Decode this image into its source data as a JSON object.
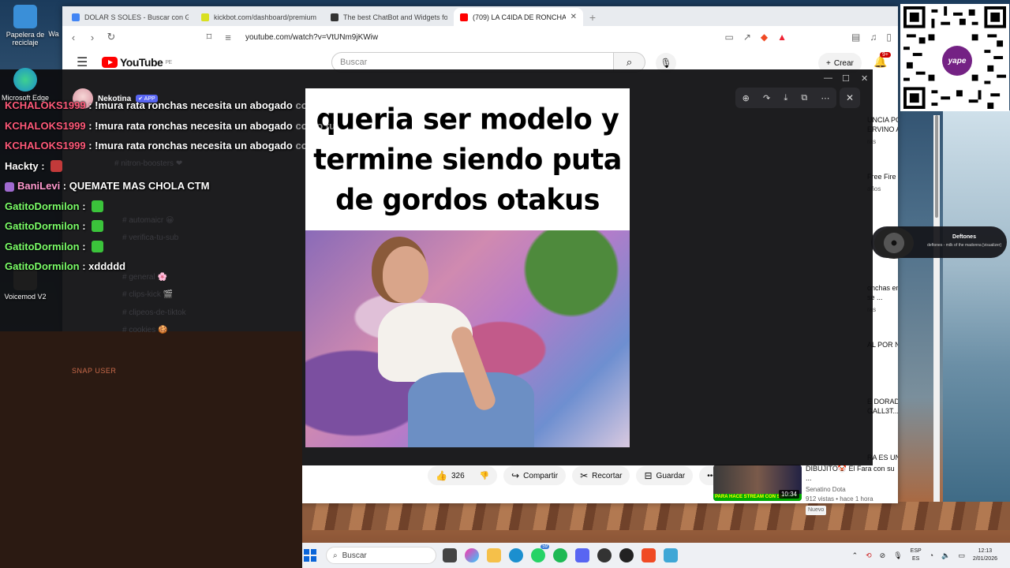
{
  "desktop": {
    "icons": [
      {
        "label": "Papelera de reciclaje",
        "color": "#3a8fd8"
      },
      {
        "label": "Microsoft Edge",
        "color": "#1b8fcf"
      },
      {
        "label": "Voicemod V2",
        "color": "#1d1d1d"
      }
    ],
    "partial_label": "Wa"
  },
  "browser": {
    "tabs": [
      {
        "title": "DOLAR S SOLES - Buscar con Google",
        "favicon_color": "#4285f4"
      },
      {
        "title": "kickbot.com/dashboard/premium",
        "favicon_color": "#d9e021"
      },
      {
        "title": "The best ChatBot and Widgets for K...",
        "favicon_color": "#333333"
      },
      {
        "title": "(709) LA C4IDA DE RONCHAS K...",
        "favicon_color": "#ff0000"
      }
    ],
    "url": "youtube.com/watch?v=VtUNm9jKWiw"
  },
  "youtube": {
    "logo_text": "YouTube",
    "region": "PE",
    "search_placeholder": "Buscar",
    "create_label": "Crear",
    "notifications_badge": "9+",
    "likes": "326",
    "share_label": "Compartir",
    "clip_label": "Recortar",
    "save_label": "Guardar",
    "recommendations": [
      {
        "title": "UNCIA POR ERVINO A ...",
        "meta": "ras"
      },
      {
        "title": "Free Fire Song ...",
        "meta": "años"
      },
      {
        "title": "onchas en la ómo se ...",
        "meta": "ras"
      },
      {
        "title": "AL POR N SU ...",
        "meta": ""
      },
      {
        "title": "E DORADA Á GALL3T...",
        "meta": ""
      },
      {
        "title": "RA ES UN",
        "meta": ""
      }
    ],
    "bottom_rec": {
      "title": "DIBUJITO🤡 El Fara con su ...",
      "channel": "Senatino Dota",
      "meta": "912 vistas • hace 1 hora",
      "badge": "Nuevo",
      "duration": "10:34",
      "thumb_banner": "PARA HACE STREAM CON SU"
    }
  },
  "overlay": {
    "bot_name": "Nekotina",
    "bot_badge": "✔ APP",
    "faded_channels": [
      "# nitron-boosters ❤",
      "# automaicr 😀",
      "# verifica-tu-sub",
      "# general 🌸",
      "# clips-kick 🎬",
      "# clipeos-de-tiktok",
      "# cookies 🍪"
    ],
    "snap_label": "SNAP USER"
  },
  "meme": {
    "caption": [
      "queria ser modelo y",
      "termine siendo puta",
      "de gordos otakus"
    ]
  },
  "chat": [
    {
      "user": "KCHALOKS1999",
      "color": "#ff5a7a",
      "msg": "!mura rata ronchas necesita un abogado",
      "overflow": "como tu"
    },
    {
      "user": "KCHALOKS1999",
      "color": "#ff5a7a",
      "msg": "!mura rata ronchas necesita un abogado",
      "overflow": "como tu"
    },
    {
      "user": "KCHALOKS1999",
      "color": "#ff5a7a",
      "msg": "!mura rata ronchas necesita un abogado",
      "overflow": "como tu"
    },
    {
      "user": "Hackty",
      "color": "#ffffff",
      "msg": "",
      "overflow": ""
    },
    {
      "user": "BaniLevi",
      "color": "#ff9ad0",
      "msg": "QUEMATE MAS CHOLA CTM",
      "overflow": ""
    },
    {
      "user": "GatitoDormilon",
      "color": "#7cff6a",
      "msg": "",
      "overflow": ""
    },
    {
      "user": "GatitoDormilon",
      "color": "#7cff6a",
      "msg": "",
      "overflow": ""
    },
    {
      "user": "GatitoDormilon",
      "color": "#7cff6a",
      "msg": "",
      "overflow": ""
    },
    {
      "user": "GatitoDormilon",
      "color": "#7cff6a",
      "msg": "xddddd",
      "overflow": ""
    }
  ],
  "deftones": {
    "title": "Deftones",
    "subtitle": "deftones - milk of the madonna [visualizer]"
  },
  "qr": {
    "brand": "yape"
  },
  "taskbar": {
    "search_placeholder": "Buscar",
    "badge": "59",
    "lang": "ESP",
    "lang_sub": "ES",
    "time": "12:13",
    "date": "2/01/2026"
  }
}
